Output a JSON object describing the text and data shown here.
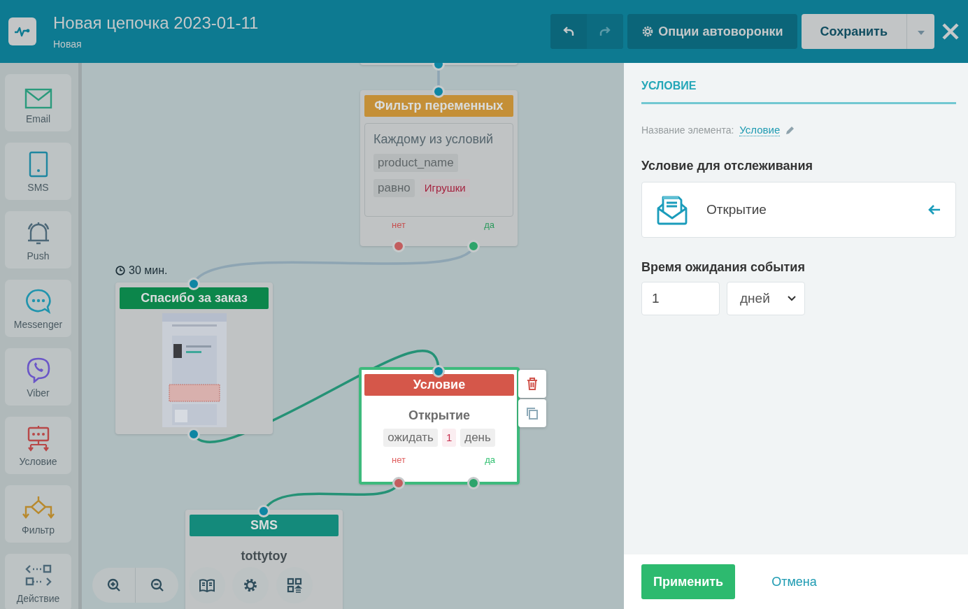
{
  "header": {
    "title": "Новая цепочка 2023-01-11",
    "status": "Новая",
    "undo_enabled": true,
    "redo_enabled": false,
    "options_button": "Опции автоворонки",
    "save_button": "Сохранить"
  },
  "palette": [
    {
      "kind": "email",
      "label": "Email"
    },
    {
      "kind": "sms",
      "label": "SMS"
    },
    {
      "kind": "push",
      "label": "Push"
    },
    {
      "kind": "messenger",
      "label": "Messenger"
    },
    {
      "kind": "viber",
      "label": "Viber"
    },
    {
      "kind": "condition",
      "label": "Условие"
    },
    {
      "kind": "filter",
      "label": "Фильтр"
    },
    {
      "kind": "action",
      "label": "Действие"
    }
  ],
  "canvas": {
    "nodes": [
      {
        "kind": "filter",
        "title": "Фильтр переменных",
        "selected": false,
        "rule": "Каждому из условий",
        "variable": "product_name",
        "operator": "равно",
        "value": "Игрушки",
        "outputs": [
          "нет",
          "да"
        ]
      },
      {
        "kind": "email",
        "title": "Спасибо за заказ",
        "selected": false,
        "delay": "30 мин."
      },
      {
        "kind": "condition",
        "title": "Условие",
        "selected": true,
        "event": "Открытие",
        "wait": [
          "ожидать",
          "1",
          "день"
        ],
        "outputs": [
          "нет",
          "да"
        ]
      },
      {
        "kind": "sms",
        "title": "SMS",
        "selected": false,
        "sender": "tottytoy"
      }
    ]
  },
  "panel": {
    "tab": "УСЛОВИЕ",
    "name_label": "Название элемента:",
    "name_value": "Условие",
    "condition_label": "Условие для отслеживания",
    "condition_value": "Открытие",
    "wait_label": "Время ожидания события",
    "wait_value": "1",
    "wait_unit": "дней",
    "apply_button": "Применить",
    "cancel_button": "Отмена"
  }
}
